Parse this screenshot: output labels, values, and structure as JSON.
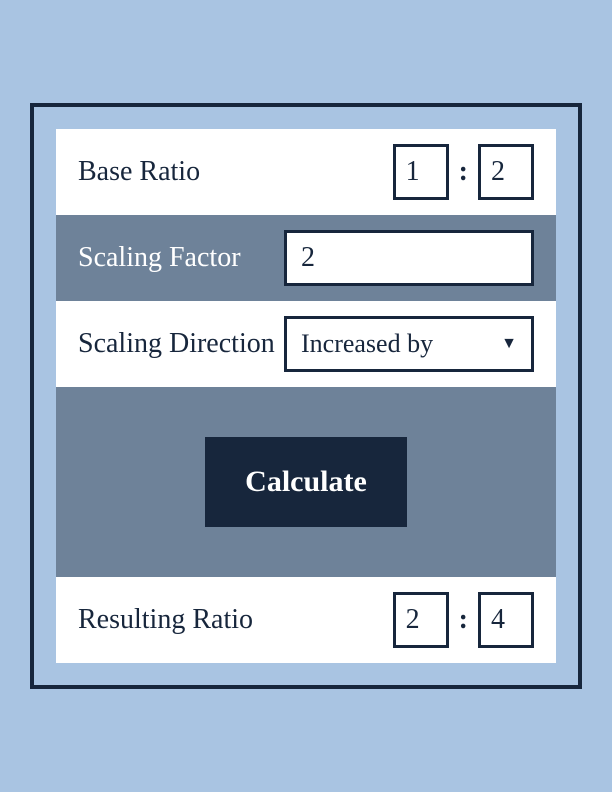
{
  "base_ratio": {
    "label": "Base Ratio",
    "value_a": "1",
    "value_b": "2",
    "separator": ":"
  },
  "scaling_factor": {
    "label": "Scaling Factor",
    "value": "2"
  },
  "scaling_direction": {
    "label": "Scaling Direction",
    "selected": "Increased by"
  },
  "calculate": {
    "label": "Calculate"
  },
  "resulting_ratio": {
    "label": "Resulting Ratio",
    "value_a": "2",
    "value_b": "4",
    "separator": ":"
  },
  "colors": {
    "pale_blue": "#a9c4e2",
    "slate": "#6e8299",
    "dark_navy": "#17263c",
    "white": "#ffffff"
  }
}
